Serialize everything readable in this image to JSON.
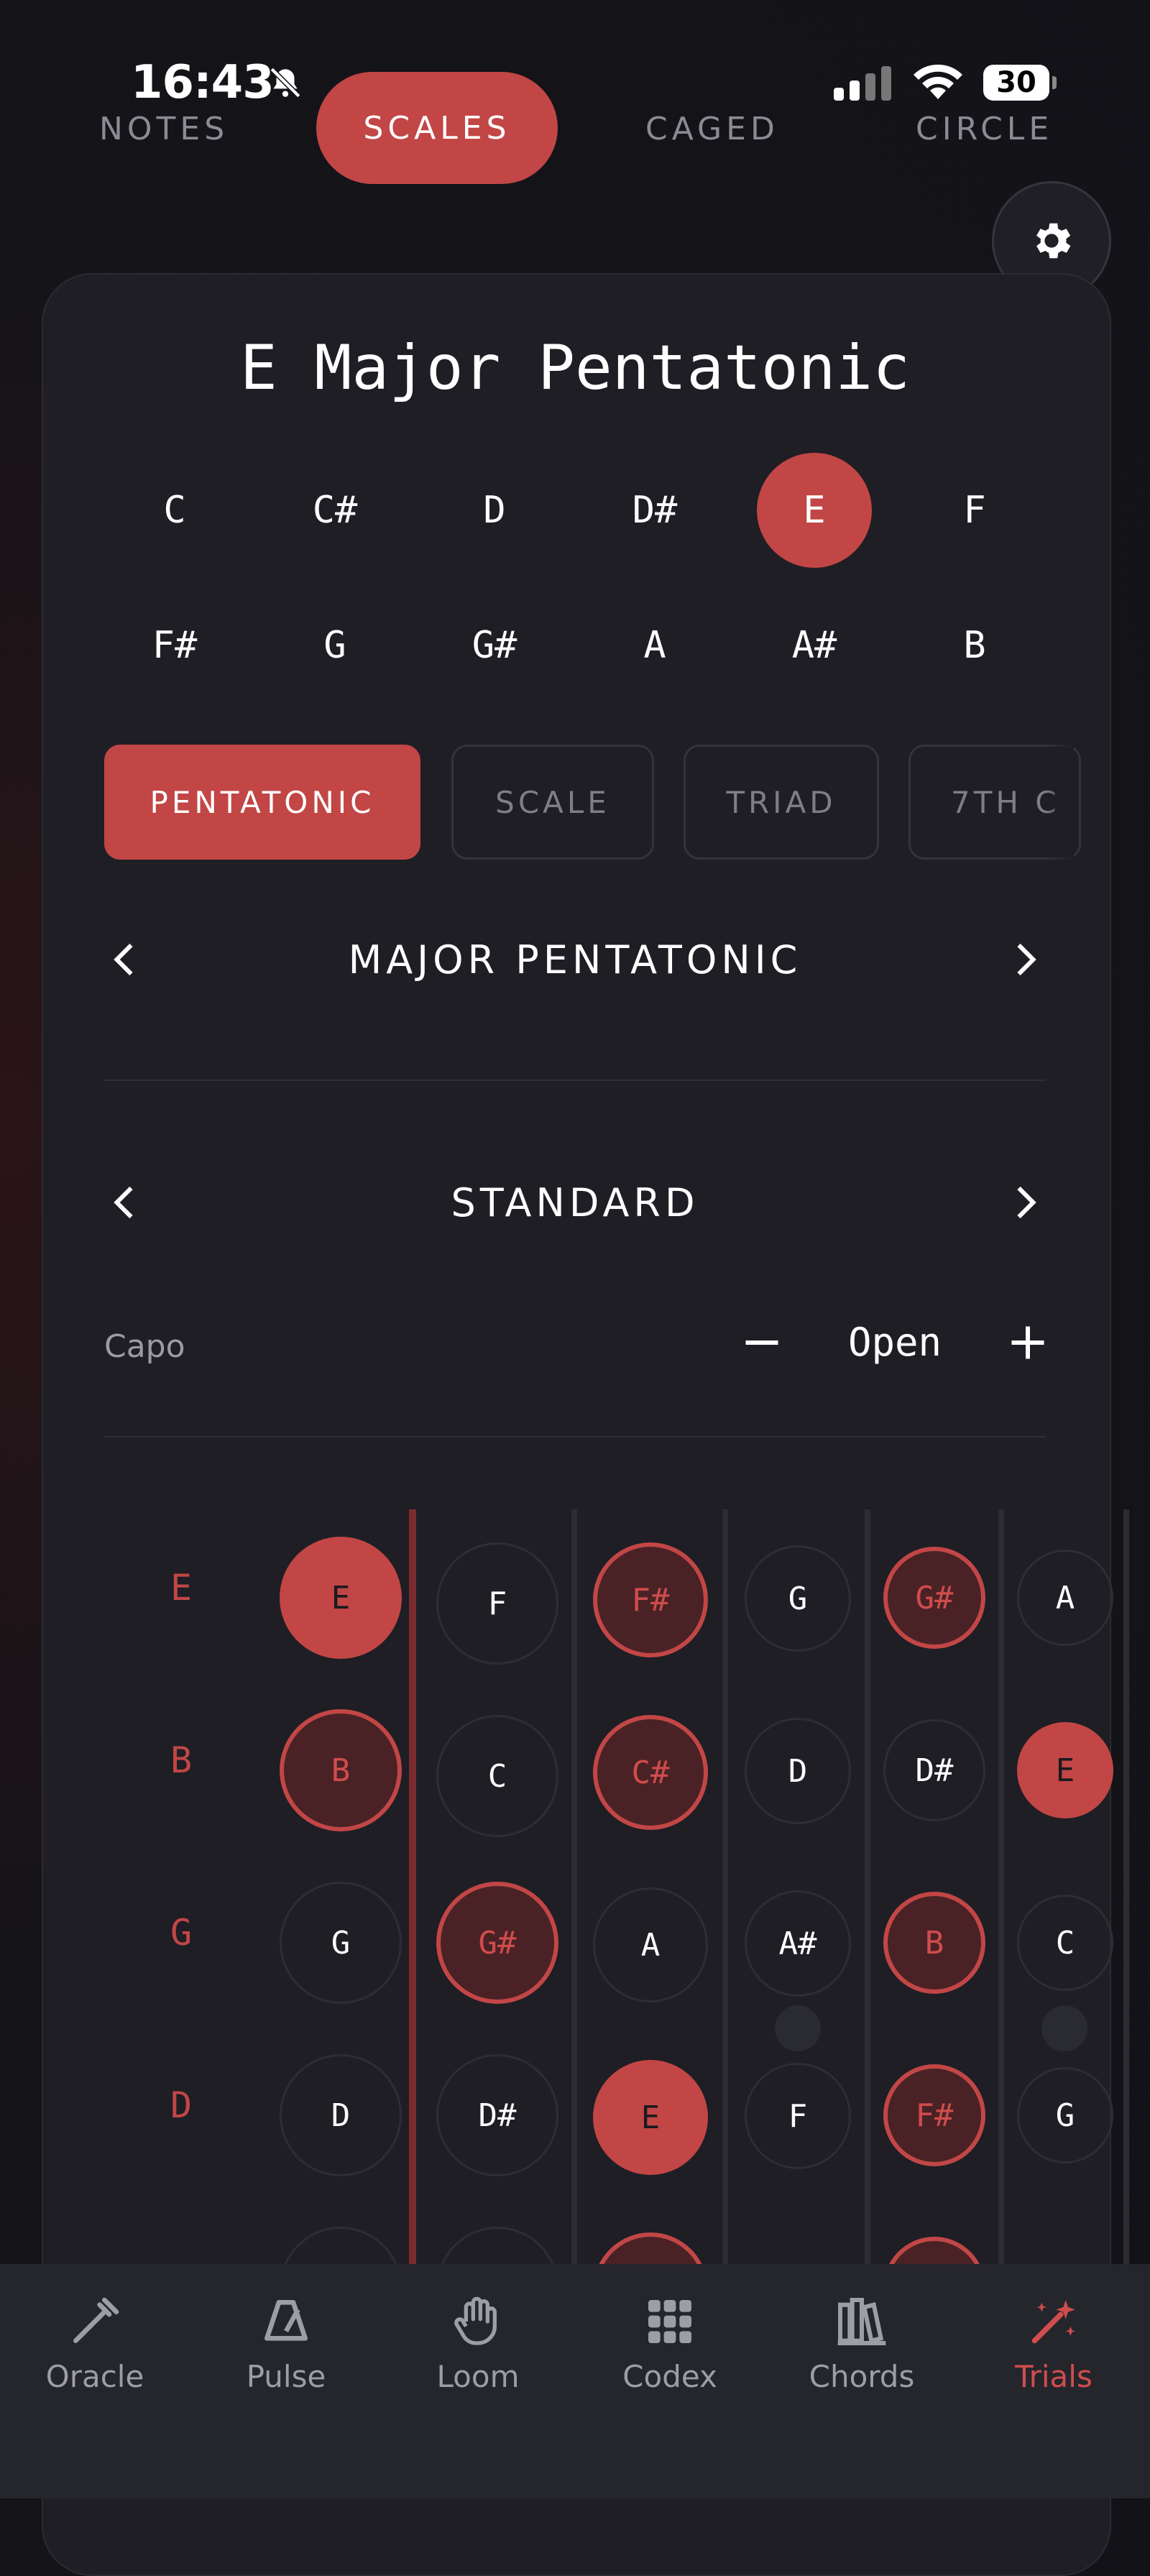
{
  "status": {
    "time": "16:43",
    "battery": "30"
  },
  "tabs": [
    {
      "label": "NOTES"
    },
    {
      "label": "SCALES"
    },
    {
      "label": "CAGED"
    },
    {
      "label": "CIRCLE"
    }
  ],
  "title": "E Major Pentatonic",
  "keys": [
    "C",
    "C#",
    "D",
    "D#",
    "E",
    "F",
    "F#",
    "G",
    "G#",
    "A",
    "A#",
    "B"
  ],
  "modes": [
    "PENTATONIC",
    "SCALE",
    "TRIAD",
    "7TH C"
  ],
  "scale_selector": {
    "label": "MAJOR PENTATONIC"
  },
  "tuning_selector": {
    "label": "STANDARD"
  },
  "capo": {
    "label": "Capo",
    "value": "Open"
  },
  "fretboard": {
    "strings": [
      "E",
      "B",
      "G",
      "D"
    ],
    "rows": [
      [
        "E",
        "F",
        "F#",
        "G",
        "G#",
        "A"
      ],
      [
        "B",
        "C",
        "C#",
        "D",
        "D#",
        "E"
      ],
      [
        "G",
        "G#",
        "A",
        "A#",
        "B",
        "C"
      ],
      [
        "D",
        "D#",
        "E",
        "F",
        "F#",
        "G"
      ]
    ]
  },
  "nav": [
    {
      "label": "Oracle"
    },
    {
      "label": "Pulse"
    },
    {
      "label": "Loom"
    },
    {
      "label": "Codex"
    },
    {
      "label": "Chords"
    },
    {
      "label": "Trials"
    }
  ],
  "colors": {
    "accent": "#c24646",
    "background": "#141419",
    "card": "#1e1e24"
  }
}
